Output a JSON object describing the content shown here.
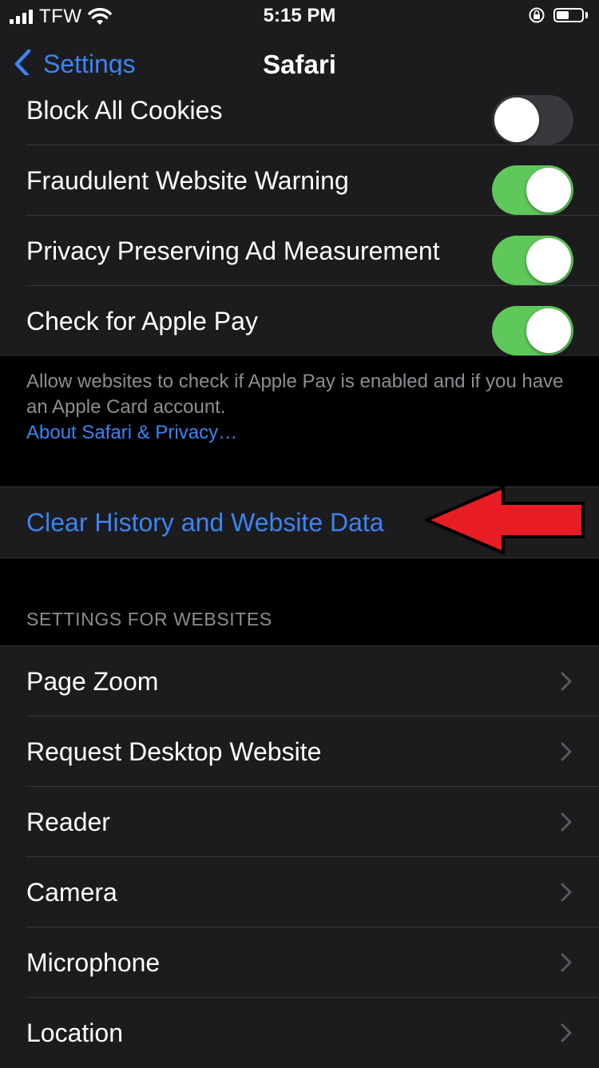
{
  "status_bar": {
    "carrier": "TFW",
    "time": "5:15 PM",
    "icons": [
      "signal-bars-icon",
      "wifi-icon",
      "rotation-lock-icon",
      "battery-icon"
    ]
  },
  "nav": {
    "back_label": "Settings",
    "title": "Safari"
  },
  "privacy_rows": [
    {
      "label": "Block All Cookies",
      "toggle": "off"
    },
    {
      "label": "Fraudulent Website Warning",
      "toggle": "on"
    },
    {
      "label": "Privacy Preserving Ad Measurement",
      "toggle": "on"
    },
    {
      "label": "Check for Apple Pay",
      "toggle": "on"
    }
  ],
  "privacy_footer": {
    "text": "Allow websites to check if Apple Pay is enabled and if you have an Apple Card account.",
    "link": "About Safari & Privacy…"
  },
  "clear_action": {
    "label": "Clear History and Website Data"
  },
  "websites_section": {
    "header": "SETTINGS FOR WEBSITES",
    "rows": [
      "Page Zoom",
      "Request Desktop Website",
      "Reader",
      "Camera",
      "Microphone",
      "Location"
    ]
  },
  "colors": {
    "accent_blue": "#3c84f2",
    "toggle_on": "#5fc85a",
    "annotation_arrow": "#e81c24"
  }
}
